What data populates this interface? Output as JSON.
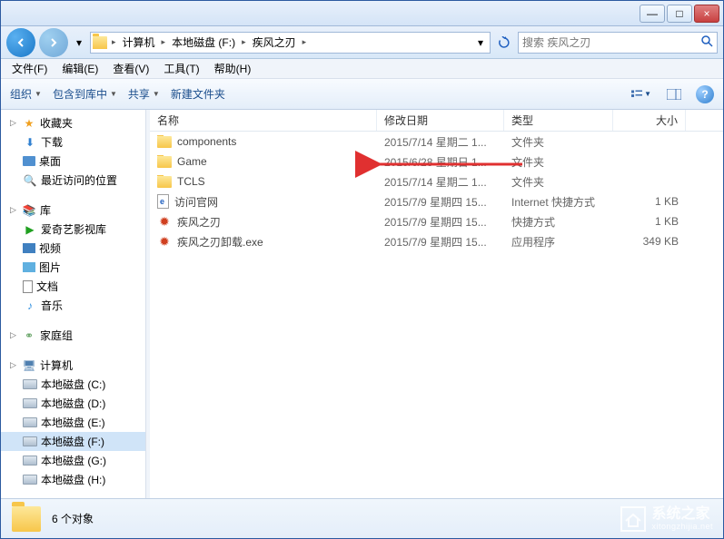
{
  "titlebar": {
    "minimize": "—",
    "maximize": "□",
    "close": "×"
  },
  "nav": {
    "path": [
      {
        "label": "计算机"
      },
      {
        "label": "本地磁盘 (F:)"
      },
      {
        "label": "疾风之刃"
      }
    ]
  },
  "search": {
    "placeholder": "搜索 疾风之刃"
  },
  "menubar": [
    {
      "label": "文件(F)"
    },
    {
      "label": "编辑(E)"
    },
    {
      "label": "查看(V)"
    },
    {
      "label": "工具(T)"
    },
    {
      "label": "帮助(H)"
    }
  ],
  "toolbar": {
    "organize": "组织",
    "include": "包含到库中",
    "share": "共享",
    "new_folder": "新建文件夹"
  },
  "sidebar": {
    "favorites": {
      "label": "收藏夹",
      "items": [
        {
          "label": "下载",
          "icon": "download"
        },
        {
          "label": "桌面",
          "icon": "desktop"
        },
        {
          "label": "最近访问的位置",
          "icon": "recent"
        }
      ]
    },
    "libraries": {
      "label": "库",
      "items": [
        {
          "label": "爱奇艺影视库",
          "icon": "iqiyi"
        },
        {
          "label": "视频",
          "icon": "video"
        },
        {
          "label": "图片",
          "icon": "pictures"
        },
        {
          "label": "文档",
          "icon": "documents"
        },
        {
          "label": "音乐",
          "icon": "music"
        }
      ]
    },
    "homegroup": {
      "label": "家庭组"
    },
    "computer": {
      "label": "计算机",
      "items": [
        {
          "label": "本地磁盘 (C:)"
        },
        {
          "label": "本地磁盘 (D:)"
        },
        {
          "label": "本地磁盘 (E:)"
        },
        {
          "label": "本地磁盘 (F:)",
          "selected": true
        },
        {
          "label": "本地磁盘 (G:)"
        },
        {
          "label": "本地磁盘 (H:)"
        }
      ]
    }
  },
  "columns": {
    "name": "名称",
    "date": "修改日期",
    "type": "类型",
    "size": "大小"
  },
  "files": [
    {
      "name": "components",
      "date": "2015/7/14 星期二 1...",
      "type": "文件夹",
      "size": "",
      "icon": "folder"
    },
    {
      "name": "Game",
      "date": "2015/6/28 星期日 1...",
      "type": "文件夹",
      "size": "",
      "icon": "folder"
    },
    {
      "name": "TCLS",
      "date": "2015/7/14 星期二 1...",
      "type": "文件夹",
      "size": "",
      "icon": "folder"
    },
    {
      "name": "访问官网",
      "date": "2015/7/9 星期四 15...",
      "type": "Internet 快捷方式",
      "size": "1 KB",
      "icon": "html"
    },
    {
      "name": "疾风之刃",
      "date": "2015/7/9 星期四 15...",
      "type": "快捷方式",
      "size": "1 KB",
      "icon": "app"
    },
    {
      "name": "疾风之刃卸载.exe",
      "date": "2015/7/9 星期四 15...",
      "type": "应用程序",
      "size": "349 KB",
      "icon": "app"
    }
  ],
  "status": {
    "count": "6 个对象"
  },
  "watermark": {
    "cn": "系统之家",
    "en": "xitongzhijia.net"
  }
}
